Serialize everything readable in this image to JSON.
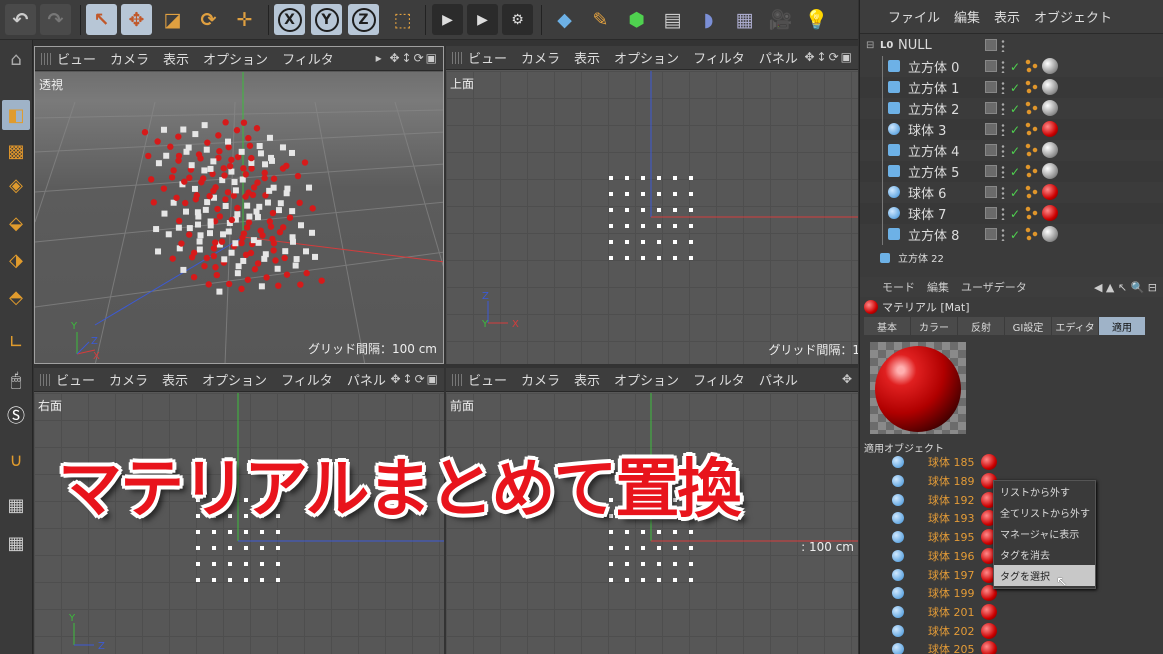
{
  "toolbar": {
    "axis_x": "X",
    "axis_y": "Y",
    "axis_z": "Z"
  },
  "viewports": {
    "menu": [
      "ビュー",
      "カメラ",
      "表示",
      "オプション",
      "フィルタ",
      "パネル"
    ],
    "perspective": {
      "label": "透視",
      "grid": "グリッド間隔：100 cm"
    },
    "top": {
      "label": "上面",
      "grid": "グリッド間隔：1"
    },
    "right": {
      "label": "右面"
    },
    "front": {
      "label": "前面",
      "grid": ": 100 cm"
    }
  },
  "object_manager": {
    "menu": [
      "ファイル",
      "編集",
      "表示",
      "オブジェクト"
    ],
    "root": "NULL",
    "root_badge": "L0",
    "rows": [
      {
        "name": "立方体 0",
        "kind": "cube",
        "material": "white"
      },
      {
        "name": "立方体 1",
        "kind": "cube",
        "material": "white"
      },
      {
        "name": "立方体 2",
        "kind": "cube",
        "material": "white"
      },
      {
        "name": "球体 3",
        "kind": "sphere",
        "material": "red"
      },
      {
        "name": "立方体 4",
        "kind": "cube",
        "material": "white"
      },
      {
        "name": "立方体 5",
        "kind": "cube",
        "material": "white"
      },
      {
        "name": "球体 6",
        "kind": "sphere",
        "material": "red"
      },
      {
        "name": "球体 7",
        "kind": "sphere",
        "material": "red"
      },
      {
        "name": "立方体 8",
        "kind": "cube",
        "material": "white"
      }
    ],
    "extra_row": "立方体 22"
  },
  "attribute_manager": {
    "menu": [
      "モード",
      "編集",
      "ユーザデータ"
    ],
    "title": "マテリアル [Mat]",
    "tabs": [
      "基本",
      "カラー",
      "反射",
      "GI設定",
      "エディタ",
      "適用"
    ],
    "active_tab": "適用",
    "applied_header": "適用オブジェクト",
    "applied": [
      "球体 185",
      "球体 189",
      "球体 192",
      "球体 193",
      "球体 195",
      "球体 196",
      "球体 197",
      "球体 199",
      "球体 201",
      "球体 202",
      "球体 205"
    ]
  },
  "context_menu": {
    "items": [
      "リストから外す",
      "全てリストから外す",
      "マネージャに表示",
      "タグを消去",
      "タグを選択"
    ],
    "highlighted": "タグを選択"
  },
  "overlay_title": "マテリアルまとめて置換",
  "colors": {
    "accent_red": "#e8141c",
    "axis_x": "#d43c3c",
    "axis_y": "#3cbc3c",
    "axis_z": "#3c5ad4",
    "selection_blue": "#9fb3c8"
  }
}
